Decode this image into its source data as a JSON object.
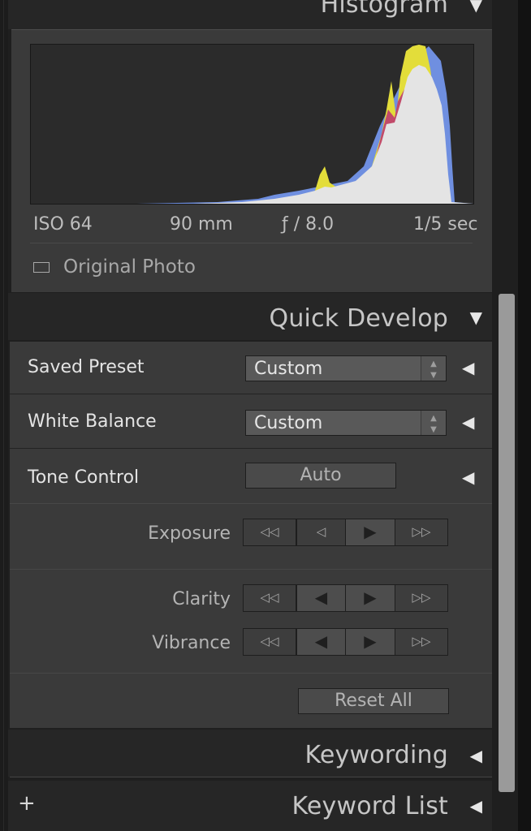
{
  "histogram": {
    "title": "Histogram",
    "iso": "ISO 64",
    "focal_length": "90 mm",
    "aperture": "ƒ / 8.0",
    "shutter": "1/5 sec",
    "original_photo_label": "Original Photo"
  },
  "quick_develop": {
    "title": "Quick Develop",
    "saved_preset": {
      "label": "Saved Preset",
      "value": "Custom"
    },
    "white_balance": {
      "label": "White Balance",
      "value": "Custom"
    },
    "tone_control": {
      "label": "Tone Control",
      "auto_label": "Auto"
    },
    "exposure_label": "Exposure",
    "clarity_label": "Clarity",
    "vibrance_label": "Vibrance",
    "reset_all_label": "Reset All"
  },
  "panels": {
    "keywording": "Keywording",
    "keyword_list": "Keyword List",
    "keyword_list_add": "+"
  },
  "glyphs": {
    "collapse": "▼",
    "expand": "◀",
    "big_left": "◁◁",
    "small_left": "◁",
    "small_right": "▷",
    "big_right": "▷▷",
    "mid_left": "◀",
    "mid_right": "▶",
    "spin": "▴▾"
  },
  "colors": {
    "panel": "#3a3a3a",
    "header": "#262626",
    "histogram_luminance": "#e4e4e4",
    "histogram_blue": "#6f8fe0",
    "histogram_yellow": "#e3dd3a"
  }
}
